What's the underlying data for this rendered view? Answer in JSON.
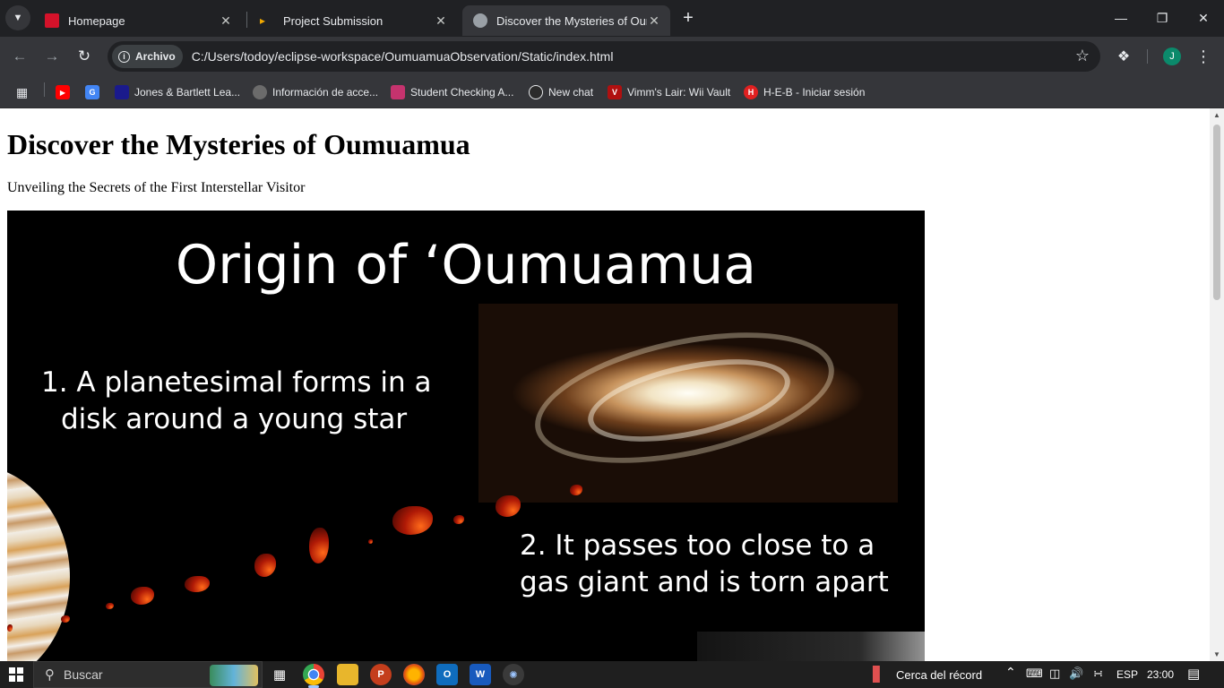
{
  "tabs": [
    {
      "title": "Homepage",
      "favicon_color": "#d4122a"
    },
    {
      "title": "Project Submission",
      "favicon_color": "#f2a900"
    },
    {
      "title": "Discover the Mysteries of Oumuamua",
      "active": true
    }
  ],
  "address_bar": {
    "chip_label": "Archivo",
    "url": "C:/Users/todoy/eclipse-workspace/OumuamuaObservation/Static/index.html"
  },
  "profile_initial": "J",
  "bookmarks": [
    {
      "label": "Jones & Bartlett Lea...",
      "color": "#1a1a8c"
    },
    {
      "label": "Información de acce...",
      "color": "#6b6b6b"
    },
    {
      "label": "Student Checking A...",
      "color": "#c5336e"
    },
    {
      "label": "New chat",
      "color": "#2b2b2b"
    },
    {
      "label": "Vimm's Lair: Wii Vault",
      "color": "#b01010"
    },
    {
      "label": "H-E-B - Iniciar sesión",
      "color": "#e02020"
    }
  ],
  "page": {
    "heading": "Discover the Mysteries of Oumuamua",
    "subheading": "Unveiling the Secrets of the First Interstellar Visitor",
    "slide": {
      "title": "Origin of ‘Oumuamua",
      "step1_line1": "1. A planetesimal forms in a",
      "step1_line2": "disk around a young star",
      "step2_line1": "2.  It passes too close to a",
      "step2_line2": "gas giant and is torn apart"
    }
  },
  "taskbar": {
    "search_placeholder": "Buscar",
    "weather": "Cerca del récord",
    "language": "ESP",
    "time": "23:00"
  }
}
